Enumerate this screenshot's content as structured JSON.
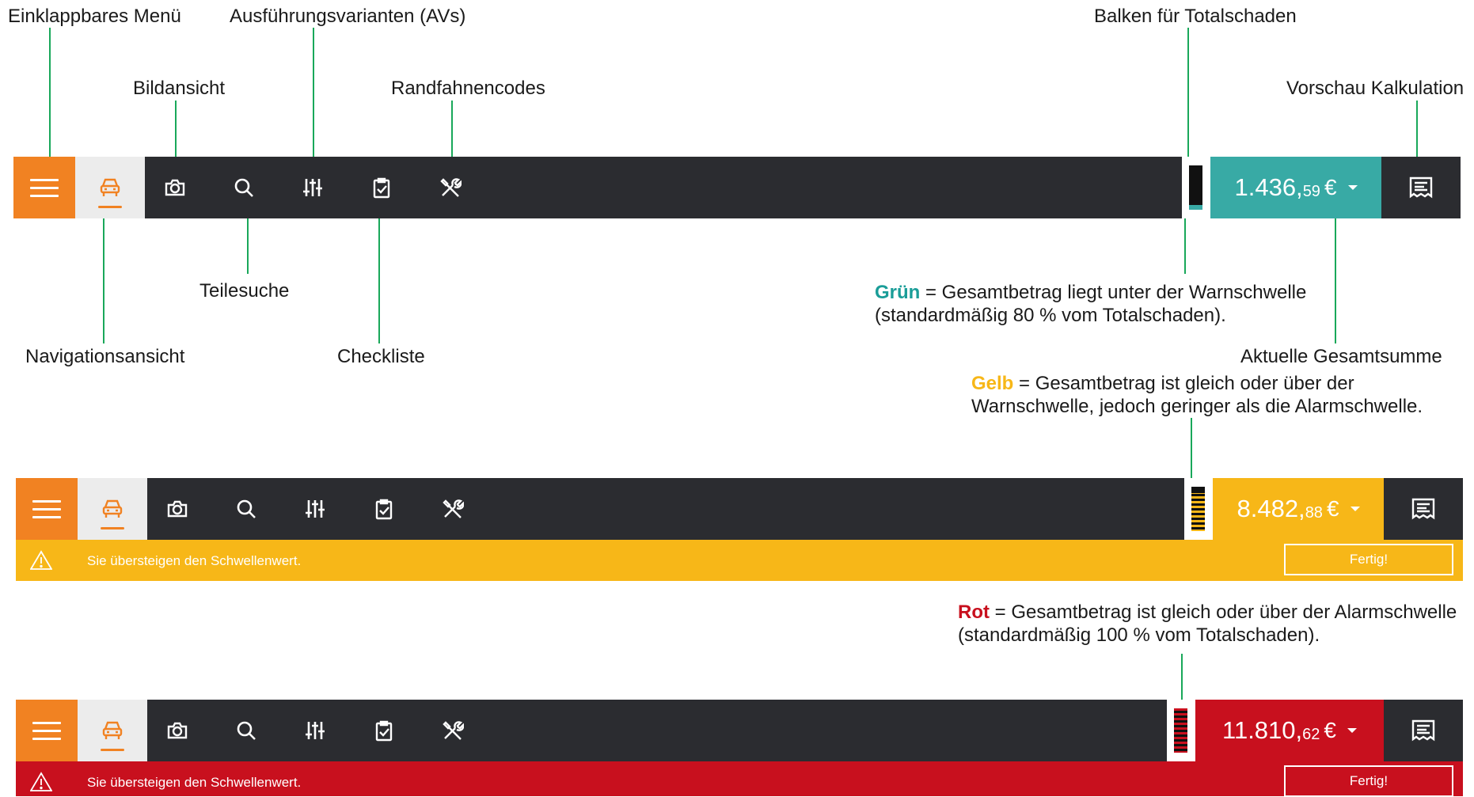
{
  "labels": {
    "menu": "Einklappbares Menü",
    "variants": "Ausführungsvarianten (AVs)",
    "image_view": "Bildansicht",
    "edge_codes": "Randfahnencodes",
    "total_loss_bar": "Balken für Totalschaden",
    "preview": "Vorschau Kalkulation",
    "parts_search": "Teilesuche",
    "navigation": "Navigationsansicht",
    "checklist": "Checkliste",
    "current_total": "Aktuelle Gesamtsumme"
  },
  "legend": {
    "green_word": "Grün",
    "green_text": " = Gesamtbetrag liegt unter der Warnschwelle",
    "green_text2": "(standardmäßig 80 % vom Totalschaden).",
    "yellow_word": "Gelb",
    "yellow_text": " = Gesamtbetrag ist gleich oder über der",
    "yellow_text2": "Warnschwelle, jedoch geringer als die Alarmschwelle.",
    "red_word": "Rot",
    "red_text": " = Gesamtbetrag ist gleich oder über der Alarmschwelle",
    "red_text2": "(standardmäßig 100 % vom Totalschaden)."
  },
  "bars": [
    {
      "state": "green",
      "amount_main": "1.436,",
      "amount_cents": "59",
      "currency": "€",
      "gauge_fill": 0.1,
      "color": "#38aaa5"
    },
    {
      "state": "yellow",
      "amount_main": "8.482,",
      "amount_cents": "88",
      "currency": "€",
      "gauge_fill": 0.85,
      "color": "#f7b718"
    },
    {
      "state": "red",
      "amount_main": "11.810,",
      "amount_cents": "62",
      "currency": "€",
      "gauge_fill": 1.0,
      "color": "#c8101e"
    }
  ],
  "warning": {
    "text": "Sie übersteigen den Schwellenwert.",
    "button": "Fertig!"
  },
  "colors": {
    "orange": "#f18222",
    "dark": "#2b2c30",
    "connector": "#19a85a"
  }
}
